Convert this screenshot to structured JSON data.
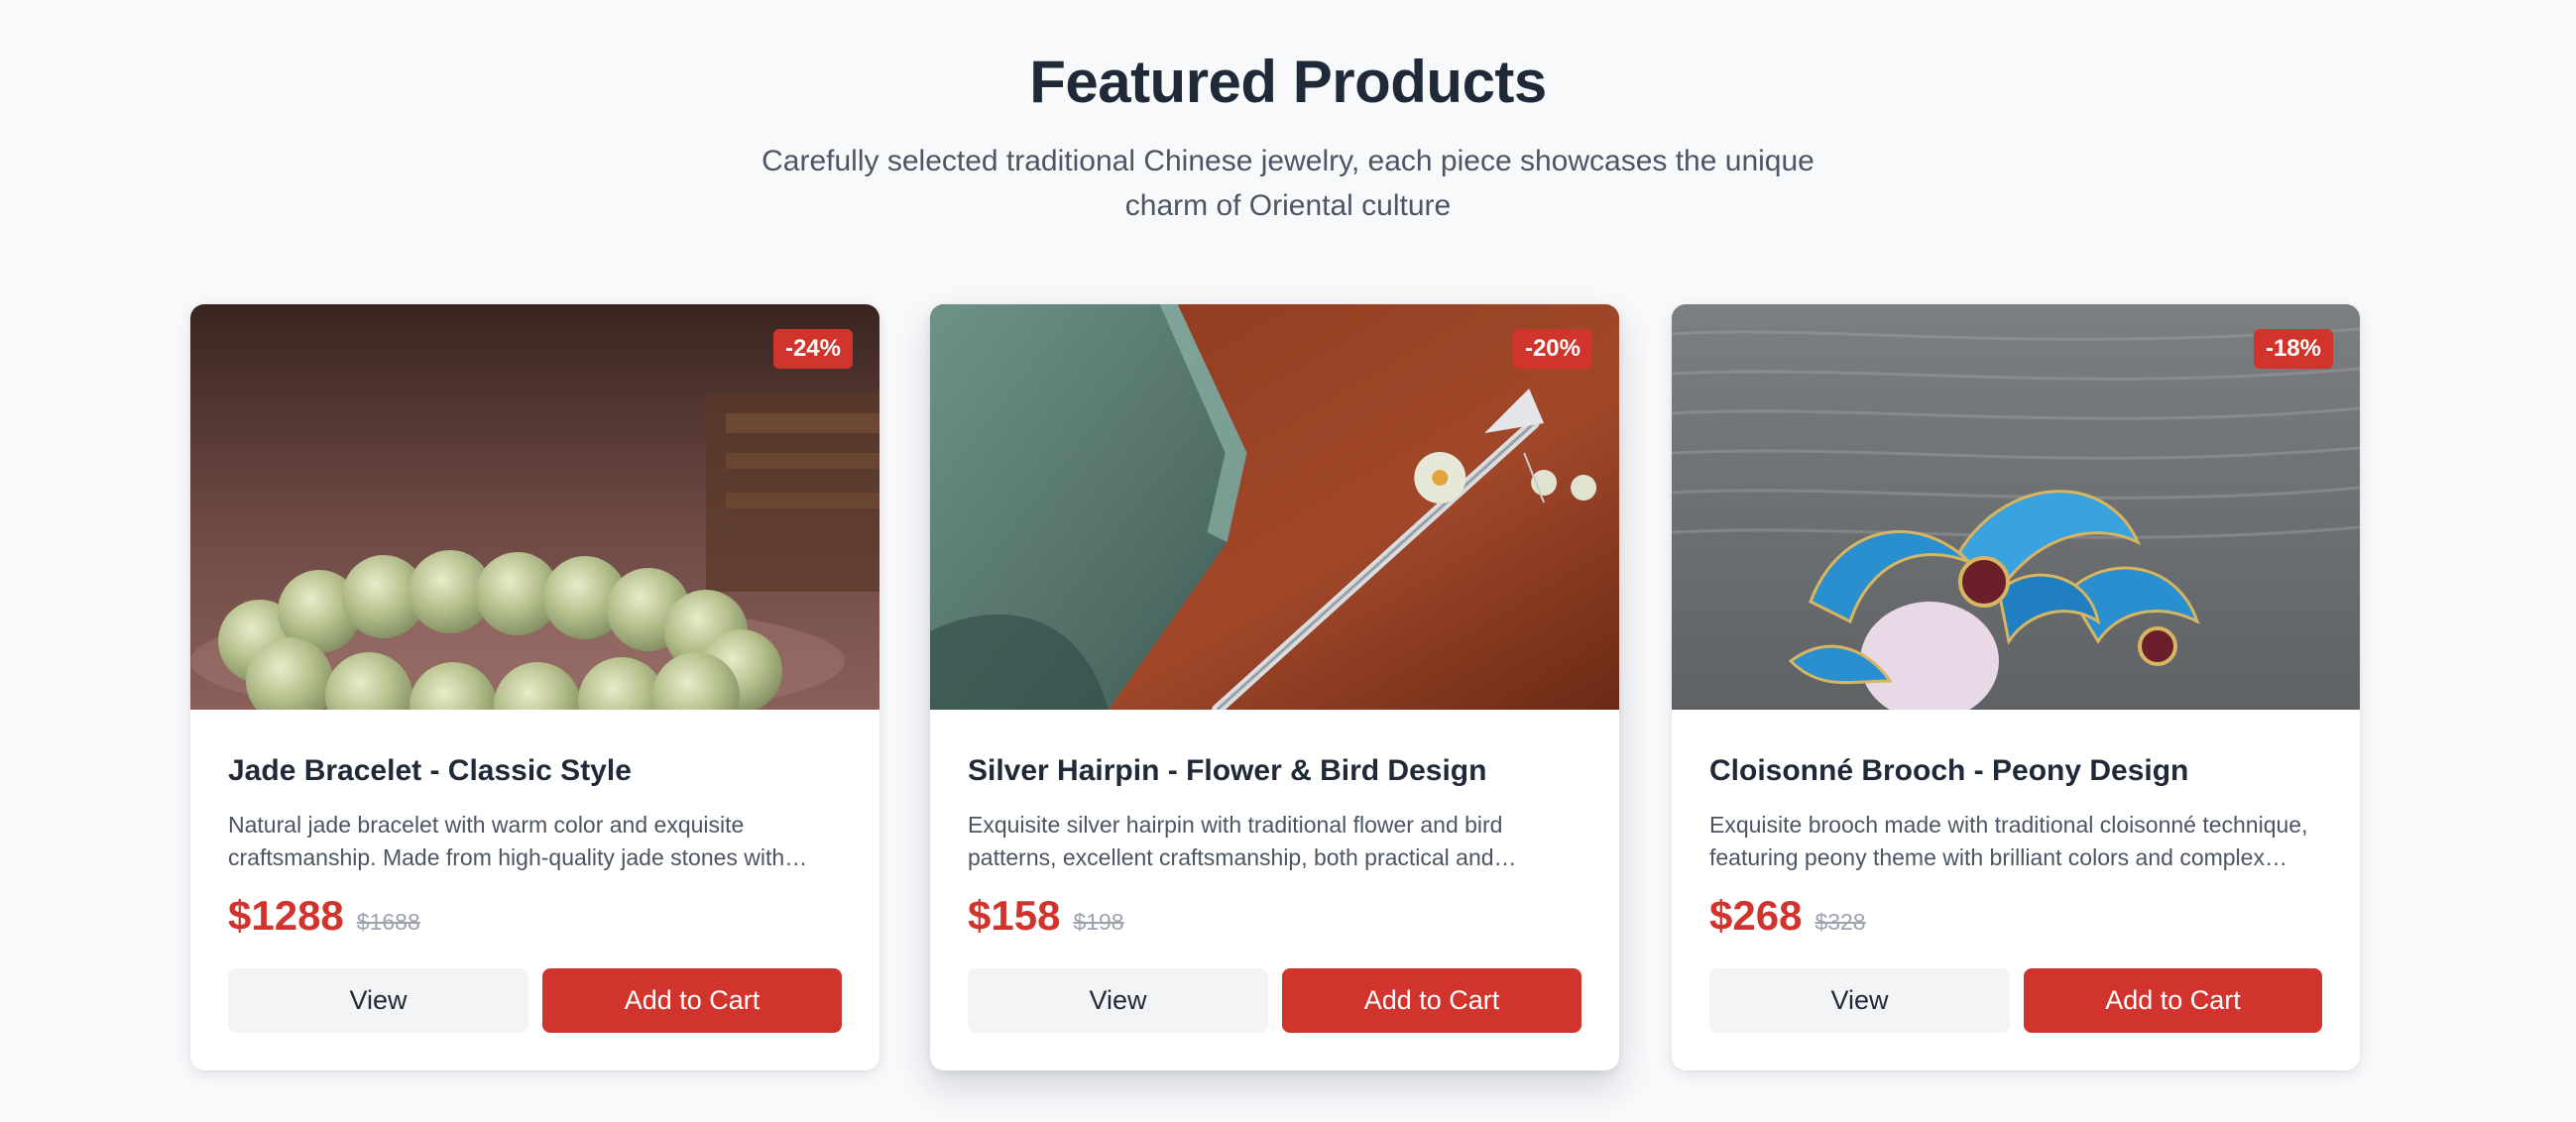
{
  "section": {
    "title": "Featured Products",
    "subtitle": "Carefully selected traditional Chinese jewelry, each piece showcases the unique charm of Oriental culture"
  },
  "products": [
    {
      "name": "Jade Bracelet - Classic Style",
      "description": "Natural jade bracelet with warm color and exquisite craftsmanship. Made from high-quality jade stones with…",
      "price": "$1288",
      "original_price": "$1688",
      "discount": "-24%",
      "view_label": "View",
      "cart_label": "Add to Cart"
    },
    {
      "name": "Silver Hairpin - Flower & Bird Design",
      "description": "Exquisite silver hairpin with traditional flower and bird patterns, excellent craftsmanship, both practical and…",
      "price": "$158",
      "original_price": "$198",
      "discount": "-20%",
      "view_label": "View",
      "cart_label": "Add to Cart"
    },
    {
      "name": "Cloisonné Brooch - Peony Design",
      "description": "Exquisite brooch made with traditional cloisonné technique, featuring peony theme with brilliant colors and complex…",
      "price": "$268",
      "original_price": "$328",
      "discount": "-18%",
      "view_label": "View",
      "cart_label": "Add to Cart"
    }
  ],
  "colors": {
    "accent": "#d0342c",
    "background": "#f8f9fb",
    "card": "#ffffff",
    "secondary_button": "#f3f4f6"
  }
}
